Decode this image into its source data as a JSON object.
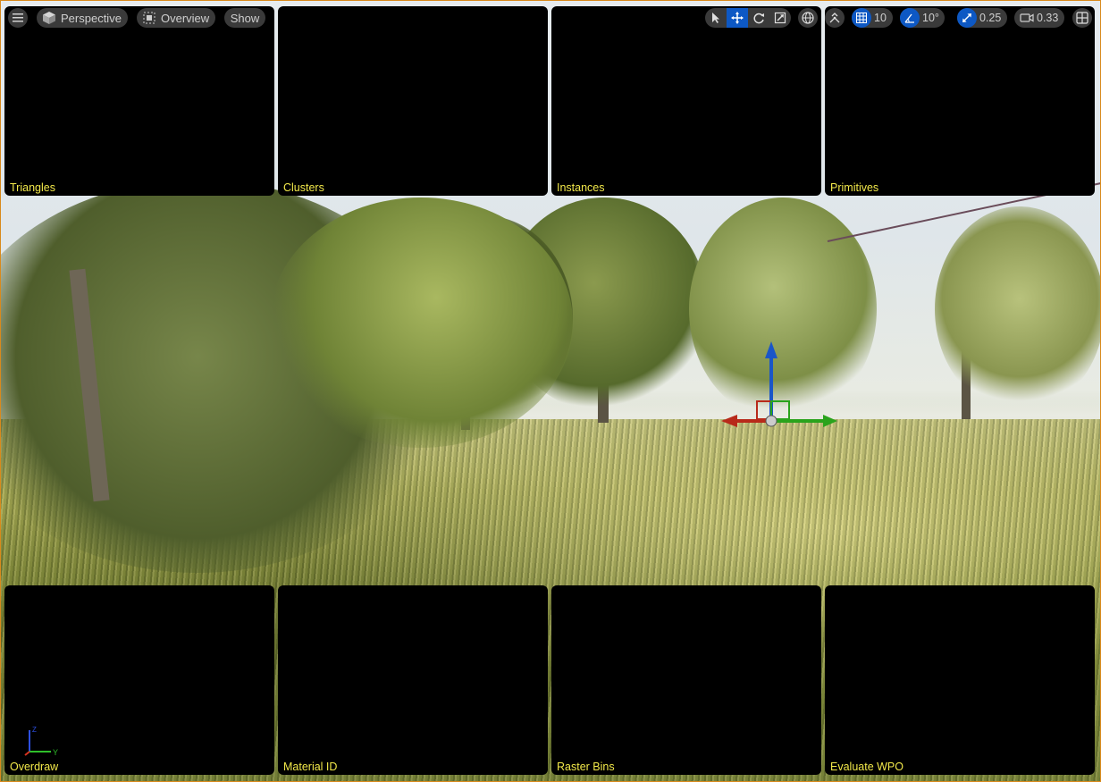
{
  "toolbar": {
    "perspective_label": "Perspective",
    "overview_label": "Overview",
    "show_label": "Show",
    "grid_snap_value": "10",
    "rotation_snap_value": "10°",
    "scale_snap_value": "0.25",
    "camera_speed_value": "0.33"
  },
  "panels": {
    "top": [
      "Triangles",
      "Clusters",
      "Instances",
      "Primitives"
    ],
    "bottom": [
      "Overdraw",
      "Material ID",
      "Raster Bins",
      "Evaluate WPO"
    ]
  },
  "axis_indicator": {
    "z": "Z",
    "y": "Y"
  },
  "colors": {
    "accent": "#0d58c4",
    "panel_label": "#f2e84a",
    "selection_border": "#d98a1c"
  }
}
